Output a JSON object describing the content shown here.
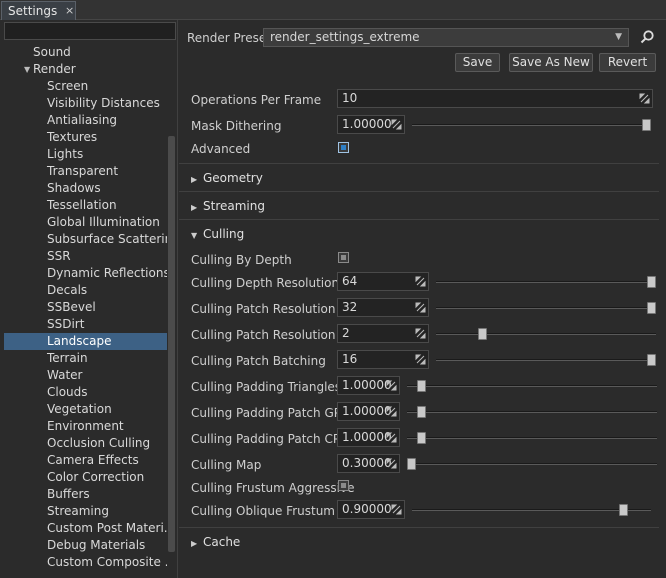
{
  "tab": {
    "label": "Settings",
    "close": "×"
  },
  "filter": {
    "value": ""
  },
  "tree": {
    "items": [
      {
        "label": "Sound",
        "level": 1
      },
      {
        "label": "Render",
        "level": 1,
        "expanded": true
      },
      {
        "label": "Screen",
        "level": 2
      },
      {
        "label": "Visibility Distances",
        "level": 2
      },
      {
        "label": "Antialiasing",
        "level": 2
      },
      {
        "label": "Textures",
        "level": 2
      },
      {
        "label": "Lights",
        "level": 2
      },
      {
        "label": "Transparent",
        "level": 2
      },
      {
        "label": "Shadows",
        "level": 2
      },
      {
        "label": "Tessellation",
        "level": 2
      },
      {
        "label": "Global Illumination",
        "level": 2
      },
      {
        "label": "Subsurface Scattering",
        "level": 2
      },
      {
        "label": "SSR",
        "level": 2
      },
      {
        "label": "Dynamic Reflections",
        "level": 2
      },
      {
        "label": "Decals",
        "level": 2
      },
      {
        "label": "SSBevel",
        "level": 2
      },
      {
        "label": "SSDirt",
        "level": 2
      },
      {
        "label": "Landscape",
        "level": 2,
        "selected": true
      },
      {
        "label": "Terrain",
        "level": 2
      },
      {
        "label": "Water",
        "level": 2
      },
      {
        "label": "Clouds",
        "level": 2
      },
      {
        "label": "Vegetation",
        "level": 2
      },
      {
        "label": "Environment",
        "level": 2
      },
      {
        "label": "Occlusion Culling",
        "level": 2
      },
      {
        "label": "Camera Effects",
        "level": 2
      },
      {
        "label": "Color Correction",
        "level": 2
      },
      {
        "label": "Buffers",
        "level": 2
      },
      {
        "label": "Streaming",
        "level": 2
      },
      {
        "label": "Custom Post Materi...",
        "level": 2
      },
      {
        "label": "Debug Materials",
        "level": 2
      },
      {
        "label": "Custom Composite ...",
        "level": 2
      }
    ]
  },
  "preset": {
    "label": "Render Preset:",
    "value": "render_settings_extreme"
  },
  "buttons": {
    "save": "Save",
    "save_as_new": "Save As New",
    "revert": "Revert"
  },
  "general": {
    "ops_label": "Operations Per Frame",
    "ops_value": "10",
    "mask_label": "Mask Dithering",
    "mask_value": "1.00000",
    "mask_level": 1.0,
    "advanced_label": "Advanced",
    "advanced_checked": true
  },
  "sections": {
    "geometry": "Geometry",
    "streaming": "Streaming",
    "culling": "Culling",
    "cache": "Cache"
  },
  "culling": {
    "by_depth_label": "Culling By Depth",
    "by_depth_checked": false,
    "rows": [
      {
        "label": "Culling Depth Resolution",
        "value": "64",
        "level": 1.0
      },
      {
        "label": "Culling Patch Resolution GPU",
        "value": "32",
        "level": 1.0
      },
      {
        "label": "Culling Patch Resolution CPU",
        "value": "2",
        "level": 0.2
      },
      {
        "label": "Culling Patch Batching",
        "value": "16",
        "level": 1.0
      }
    ],
    "rows2": [
      {
        "label": "Culling Padding Triangles",
        "value": "1.00000",
        "level": 0.04
      },
      {
        "label": "Culling Padding Patch GPU",
        "value": "1.00000",
        "level": 0.04
      },
      {
        "label": "Culling Padding Patch CPU",
        "value": "1.00000",
        "level": 0.04
      },
      {
        "label": "Culling Map",
        "value": "0.30000",
        "level": 0.0
      }
    ],
    "frustum_label": "Culling Frustum Aggressive",
    "frustum_checked": false,
    "oblique_label": "Culling Oblique Frustum",
    "oblique_value": "0.90000",
    "oblique_level": 0.9
  },
  "colors": {
    "selection": "#3d6185",
    "accent": "#2d7fc6"
  }
}
